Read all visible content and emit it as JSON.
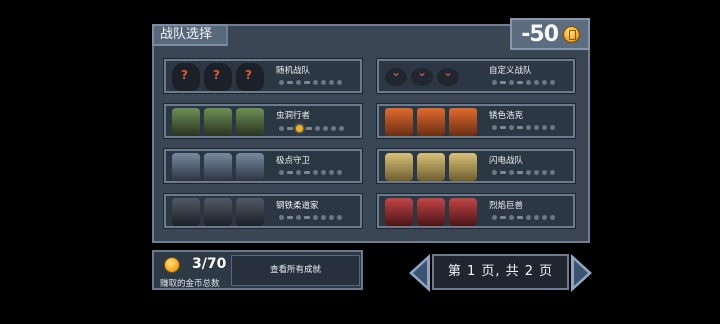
{
  "header": {
    "title": "战队选择",
    "coins": "-50",
    "coin_icon": "gold-coin"
  },
  "teams": [
    {
      "name": "随机战队",
      "units": [
        "mystery",
        "mystery",
        "mystery"
      ],
      "progress_active": null
    },
    {
      "name": "自定义战队",
      "units": [
        "empty-slot",
        "empty-slot",
        "empty-slot"
      ],
      "progress_active": null
    },
    {
      "name": "虫洞行者",
      "units": [
        "green",
        "green",
        "green"
      ],
      "progress_active": 3
    },
    {
      "name": "锈色浩克",
      "units": [
        "orange",
        "orange",
        "orange"
      ],
      "progress_active": null
    },
    {
      "name": "极点守卫",
      "units": [
        "steel",
        "steel",
        "steel"
      ],
      "progress_active": null
    },
    {
      "name": "闪电战队",
      "units": [
        "yellow",
        "yellow",
        "yellow"
      ],
      "progress_active": null
    },
    {
      "name": "钢铁柔道家",
      "units": [
        "dark",
        "dark",
        "dark"
      ],
      "progress_active": null
    },
    {
      "name": "烈焰巨兽",
      "units": [
        "red",
        "red",
        "red"
      ],
      "progress_active": null
    }
  ],
  "stats": {
    "coins_earned": "3/70",
    "coins_earned_label": "赚取的金币总数",
    "view_achievements": "查看所有成就"
  },
  "pagination": {
    "text": "第 1 页, 共 2 页",
    "current": 1,
    "total": 2
  },
  "colors": {
    "panel": "#3a4654",
    "card": "#2c3744",
    "border": "#6b7b8d",
    "arrow": "#8da5c2",
    "coin": "#f0a51c"
  }
}
